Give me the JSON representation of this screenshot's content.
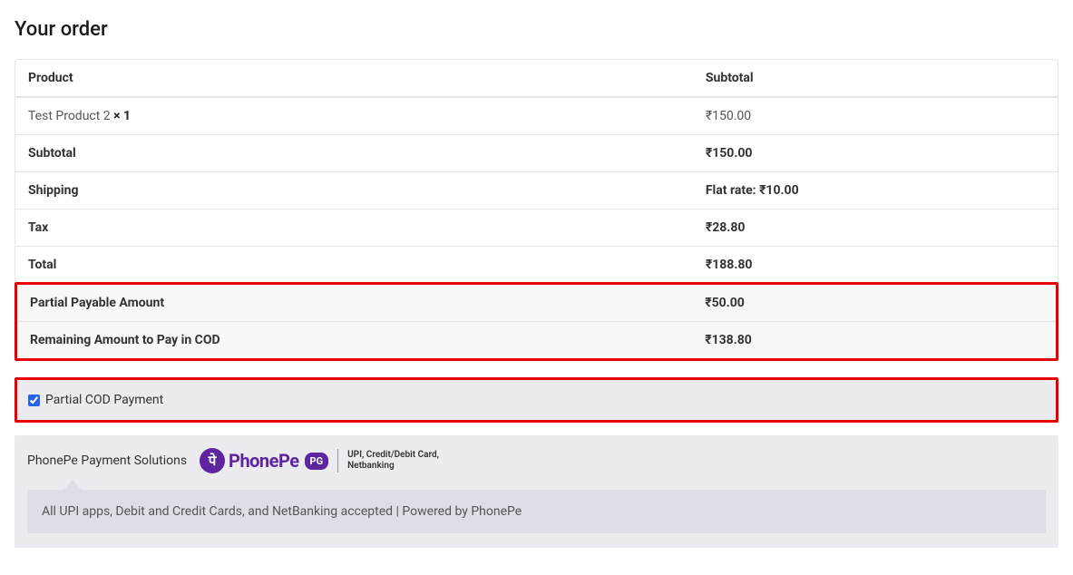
{
  "heading": "Your order",
  "table": {
    "head_product": "Product",
    "head_subtotal": "Subtotal",
    "product_name": "Test Product 2 ",
    "product_qty": " × 1",
    "product_price": "₹150.00",
    "subtotal_label": "Subtotal",
    "subtotal_value": "₹150.00",
    "shipping_label": "Shipping",
    "shipping_value": "Flat rate: ₹10.00",
    "tax_label": "Tax",
    "tax_value": "₹28.80",
    "total_label": "Total",
    "total_value": "₹188.80",
    "partial_label": "Partial Payable Amount",
    "partial_value": "₹50.00",
    "remaining_label": "Remaining Amount to Pay in COD",
    "remaining_value": "₹138.80"
  },
  "partial_cod": {
    "label": "Partial COD Payment",
    "checked": true
  },
  "payment_method": {
    "title": "PhonePe Payment Solutions",
    "logo_symbol": "पे",
    "logo_text": "PhonePe",
    "pg_badge": "PG",
    "subtext_line1": "UPI, Credit/Debit Card,",
    "subtext_line2": "Netbanking",
    "description": "All UPI apps, Debit and Credit Cards, and NetBanking accepted | Powered by PhonePe"
  }
}
